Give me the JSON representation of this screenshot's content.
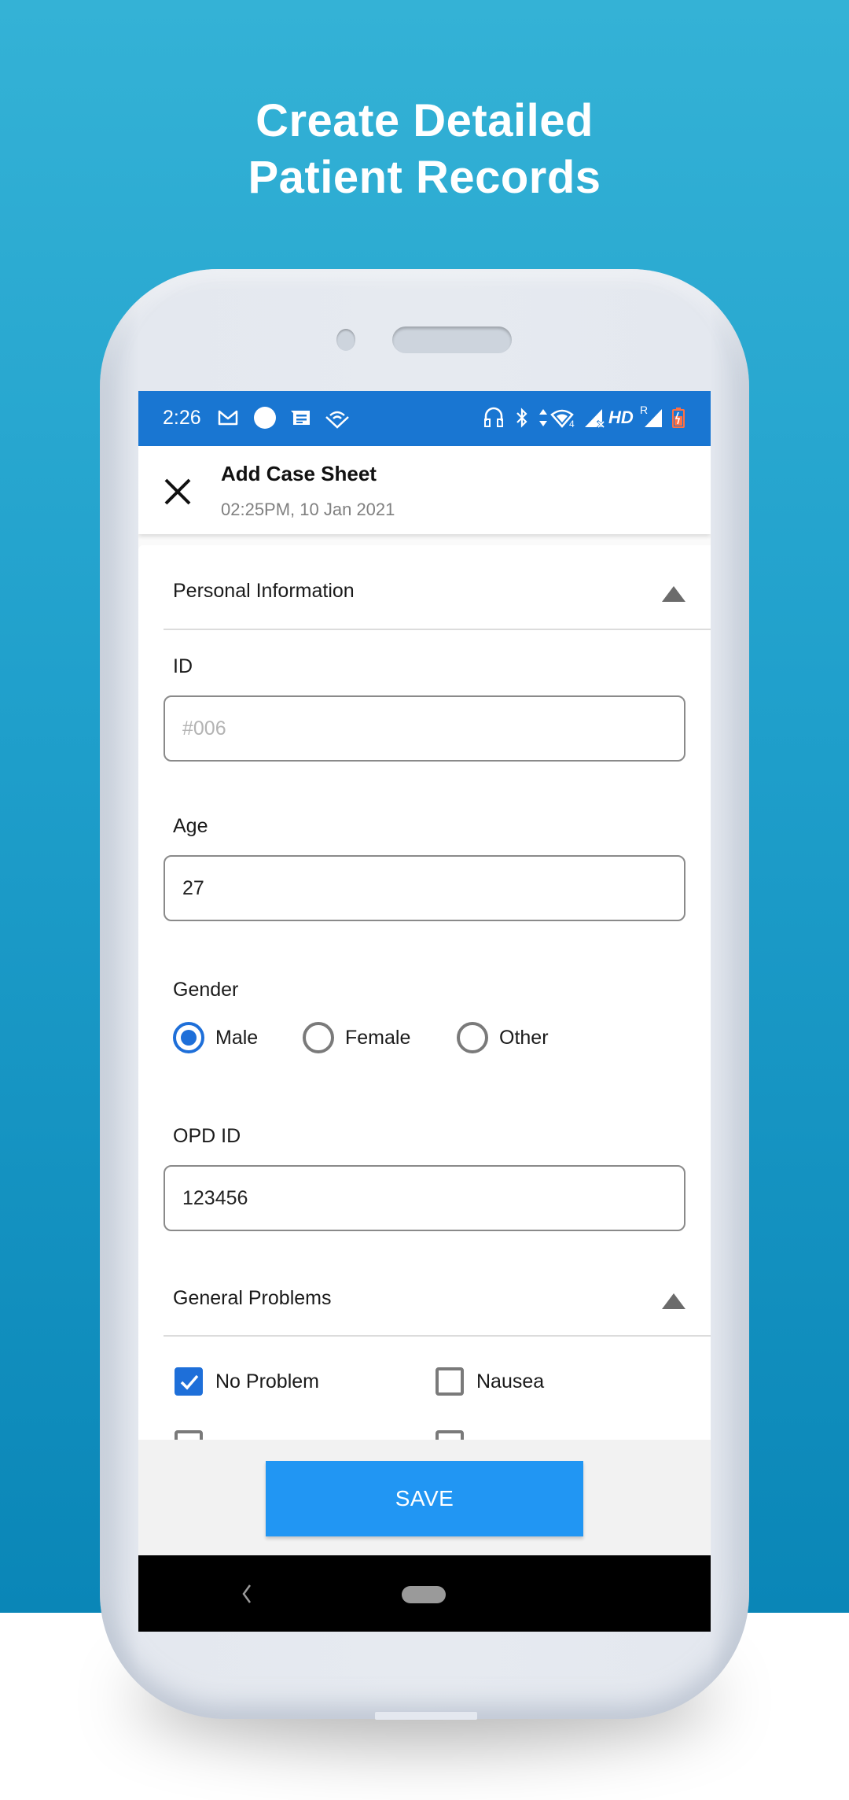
{
  "promo": {
    "headline_line1": "Create Detailed",
    "headline_line2": "Patient Records",
    "background_color": "#1f9fcb"
  },
  "status_bar": {
    "time": "2:26",
    "left_icons": [
      "gmail-icon",
      "circle-notification-icon",
      "message-icon",
      "airdrop-wifi-icon"
    ],
    "right_icons": [
      "headphones-icon",
      "bluetooth-icon",
      "data-arrows-icon",
      "wifi-icon",
      "signal-x-icon",
      "hd-icon",
      "roaming-signal-icon",
      "battery-charging-icon"
    ],
    "hd_label": "HD",
    "roaming_label": "R",
    "color": "#1976d2"
  },
  "app_bar": {
    "title": "Add Case Sheet",
    "subtitle": "02:25PM, 10 Jan 2021"
  },
  "sections": {
    "personal": {
      "title": "Personal Information",
      "fields": {
        "id": {
          "label": "ID",
          "value": "",
          "placeholder": "#006"
        },
        "age": {
          "label": "Age",
          "value": "27"
        },
        "gender": {
          "label": "Gender",
          "options": [
            "Male",
            "Female",
            "Other"
          ],
          "selected": "Male"
        },
        "opd_id": {
          "label": "OPD ID",
          "value": "123456"
        }
      }
    },
    "general_problems": {
      "title": "General Problems",
      "options": [
        {
          "label": "No Problem",
          "checked": true
        },
        {
          "label": "Nausea",
          "checked": false
        }
      ]
    }
  },
  "actions": {
    "save_label": "SAVE",
    "save_color": "#2196f3"
  },
  "accent_color": "#1e6fd9"
}
